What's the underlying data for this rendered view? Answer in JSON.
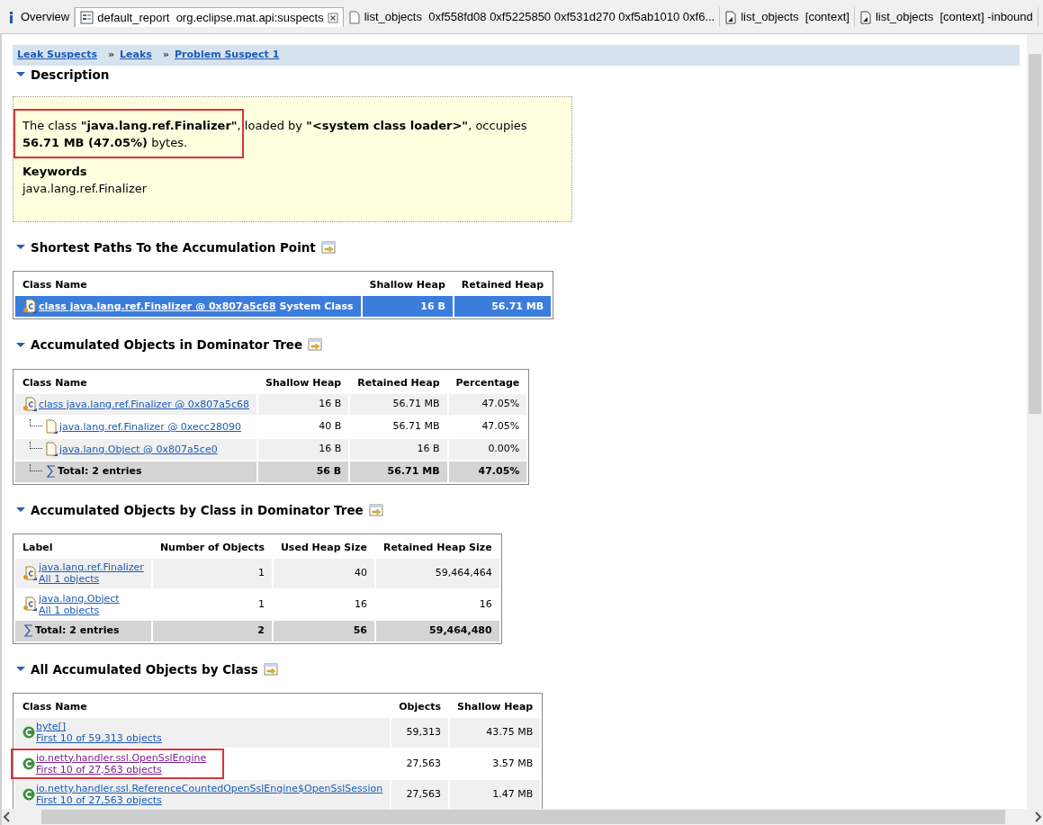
{
  "tabs": [
    {
      "label": "Overview",
      "kind": "info",
      "selected": false
    },
    {
      "label": "default_report  org.eclipse.mat.api:suspects",
      "kind": "report",
      "selected": true
    },
    {
      "label": "list_objects  0xf558fd08 0xf5225850 0xf531d270 0xf5ab1010 0xf6...",
      "kind": "page",
      "selected": false
    },
    {
      "label": "list_objects  [context]",
      "kind": "query",
      "selected": false
    },
    {
      "label": "list_objects  [context] -inbound",
      "kind": "query",
      "selected": false
    }
  ],
  "breadcrumb": [
    {
      "label": "Leak Suspects"
    },
    {
      "separator": "»",
      "label": "Leaks"
    },
    {
      "separator": "»",
      "label": "Problem Suspect 1"
    }
  ],
  "sections": [
    {
      "kind": "description",
      "title": "Description",
      "text": "The class **\"java.lang.ref.Finalizer\"**, loaded by **\"<system class loader>\"**, occupies **56.71 MB (47.05%)** bytes.",
      "highlighted": true,
      "keywords_label": "Keywords",
      "keywords": "java.lang.ref.Finalizer"
    },
    {
      "kind": "table",
      "title": "Shortest Paths To the Accumulation Point",
      "columns": [
        "Class Name",
        "Shallow Heap",
        "Retained Heap"
      ],
      "rows": [
        {
          "kind": "class",
          "selected": true,
          "suffix": "System Class",
          "cells": [
            "class java.lang.ref.Finalizer @ 0x807a5c68",
            "16 B",
            "56.71 MB"
          ]
        }
      ]
    },
    {
      "kind": "table",
      "title": "Accumulated Objects in Dominator Tree",
      "columns": [
        "Class Name",
        "Shallow Heap",
        "Retained Heap",
        "Percentage"
      ],
      "rows": [
        {
          "kind": "class",
          "selected": false,
          "cells": [
            "class java.lang.ref.Finalizer @ 0x807a5c68",
            "16 B",
            "56.71 MB",
            "47.05%"
          ],
          "children": [
            {
              "kind": "object",
              "selected": false,
              "cells": [
                "java.lang.ref.Finalizer @ 0xecc28090",
                "40 B",
                "56.71 MB",
                "47.05%"
              ]
            },
            {
              "kind": "object",
              "selected": false,
              "cells": [
                "java.lang.Object @ 0x807a5ce0",
                "16 B",
                "16 B",
                "0.00%"
              ]
            }
          ]
        },
        {
          "kind": "total",
          "cells": [
            "Total: 2 entries",
            "56 B",
            "56.71 MB",
            "47.05%"
          ]
        }
      ]
    },
    {
      "kind": "table",
      "title": "Accumulated Objects by Class in Dominator Tree",
      "columns": [
        "Label",
        "Number of Objects",
        "Used Heap Size",
        "Retained Heap Size"
      ],
      "rows": [
        {
          "kind": "class",
          "selected": false,
          "sub": "All 1 objects",
          "cells": [
            "java.lang.ref.Finalizer",
            "1",
            "40",
            "59,464,464"
          ]
        },
        {
          "kind": "class",
          "selected": false,
          "sub": "All 1 objects",
          "cells": [
            "java.lang.Object",
            "1",
            "16",
            "16"
          ]
        },
        {
          "kind": "total",
          "cells": [
            "Total: 2 entries",
            "2",
            "56",
            "59,464,480"
          ]
        }
      ]
    },
    {
      "kind": "table",
      "title": "All Accumulated Objects by Class",
      "columns": [
        "Class Name",
        "Objects",
        "Shallow Heap"
      ],
      "rows": [
        {
          "kind": "class-green",
          "selected": false,
          "visited": false,
          "highlighted": false,
          "sub": "First 10 of 59,313 objects",
          "cells": [
            "byte[]",
            "59,313",
            "43.75 MB"
          ]
        },
        {
          "kind": "class-green",
          "selected": false,
          "visited": true,
          "highlighted": true,
          "sub": "First 10 of 27,563 objects",
          "cells": [
            "io.netty.handler.ssl.OpenSslEngine",
            "27,563",
            "3.57 MB"
          ]
        },
        {
          "kind": "class-green",
          "selected": false,
          "visited": false,
          "highlighted": false,
          "sub": "First 10 of 27,563 objects",
          "cells": [
            "io.netty.handler.ssl.ReferenceCountedOpenSslEngine$OpenSslSession",
            "27,563",
            "1.47 MB"
          ]
        }
      ]
    }
  ]
}
